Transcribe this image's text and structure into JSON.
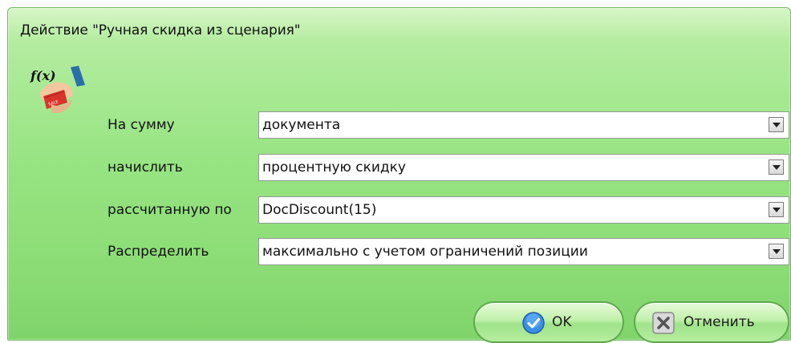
{
  "dialog": {
    "title": "Действие \"Ручная скидка из сценария\""
  },
  "icon": {
    "name": "function-discount-card-icon",
    "text": "f(x)",
    "card_text": "SALE"
  },
  "form": {
    "rows": [
      {
        "label": "На сумму",
        "value": "документа"
      },
      {
        "label": "начислить",
        "value": "процентную скидку"
      },
      {
        "label": "рассчитанную по",
        "value": "DocDiscount(15)"
      },
      {
        "label": "Распределить",
        "value": "максимально с учетом ограничений позиции"
      }
    ]
  },
  "buttons": {
    "ok_label": "OK",
    "cancel_label": "Отменить"
  },
  "colors": {
    "dialog_green": "#98e483",
    "button_border": "#5fa84e",
    "ok_icon_blue": "#3a8ee6",
    "cancel_icon_gray": "#8a8a8a"
  }
}
